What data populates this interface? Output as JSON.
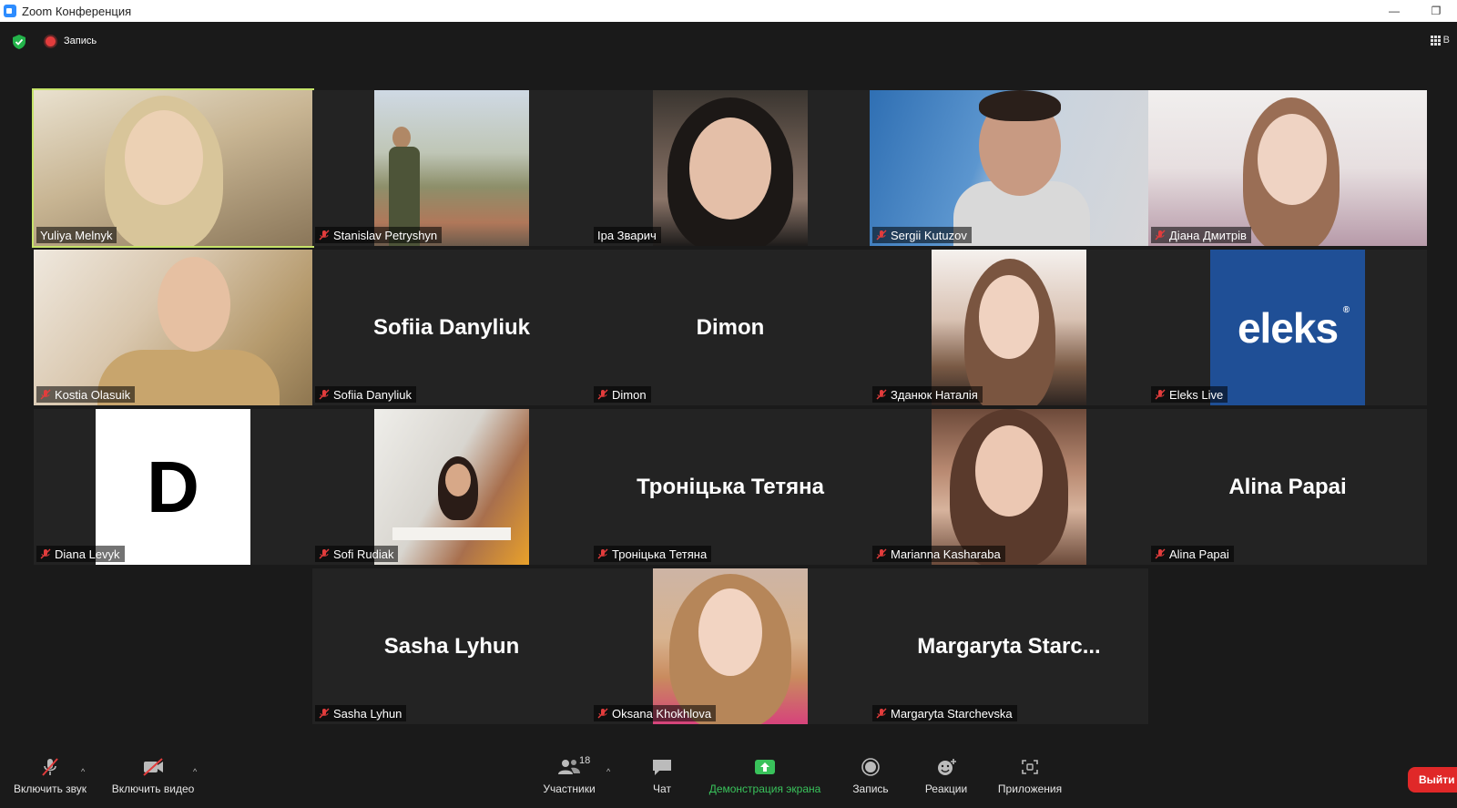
{
  "window": {
    "title": "Zoom Конференция",
    "minimize": "—",
    "restore": "❐"
  },
  "topbar": {
    "recording_label": "Запись",
    "view_label": "В"
  },
  "participants": [
    {
      "name": "Yuliya Melnyk",
      "muted": false,
      "active": true
    },
    {
      "name": "Stanislav Petryshyn",
      "muted": true
    },
    {
      "name": "Іра Зварич",
      "muted": false
    },
    {
      "name": "Sergii Kutuzov",
      "muted": true
    },
    {
      "name": "Діана Дмитрів",
      "muted": true
    },
    {
      "name": "Kostia Olasuik",
      "muted": true
    },
    {
      "name": "Sofiia Danyliuk",
      "display": "Sofiia Danyliuk",
      "muted": true
    },
    {
      "name": "Dimon",
      "display": "Dimon",
      "muted": true
    },
    {
      "name": "Зданюк Наталія",
      "muted": true
    },
    {
      "name": "Eleks Live",
      "muted": true,
      "logo": "eleks",
      "logo_mark": "®"
    },
    {
      "name": "Diana Levyk",
      "muted": true,
      "letter": "D"
    },
    {
      "name": "Sofi Rudiak",
      "muted": true
    },
    {
      "name": "Троніцька Тетяна",
      "display": "Троніцька Тетяна",
      "muted": true
    },
    {
      "name": "Marianna Kasharaba",
      "muted": true
    },
    {
      "name": "Alina Papai",
      "display": "Alina Papai",
      "muted": true
    },
    {
      "name": "Sasha Lyhun",
      "display": "Sasha Lyhun",
      "muted": true
    },
    {
      "name": "Oksana Khokhlova",
      "muted": true
    },
    {
      "name": "Margaryta Starchevska",
      "display": "Margaryta  Starc...",
      "muted": true
    }
  ],
  "toolbar": {
    "unmute_label": "Включить звук",
    "video_label": "Включить видео",
    "participants_label": "Участники",
    "participants_count": "18",
    "chat_label": "Чат",
    "share_label": "Демонстрация экрана",
    "record_label": "Запись",
    "reactions_label": "Реакции",
    "apps_label": "Приложения",
    "exit_label": "Выйти"
  },
  "colors": {
    "active_speaker": "#c6e36a",
    "share_green": "#39c25b",
    "exit_red": "#e02828",
    "muted_red": "#e23c3c",
    "background": "#1a1a1a"
  }
}
